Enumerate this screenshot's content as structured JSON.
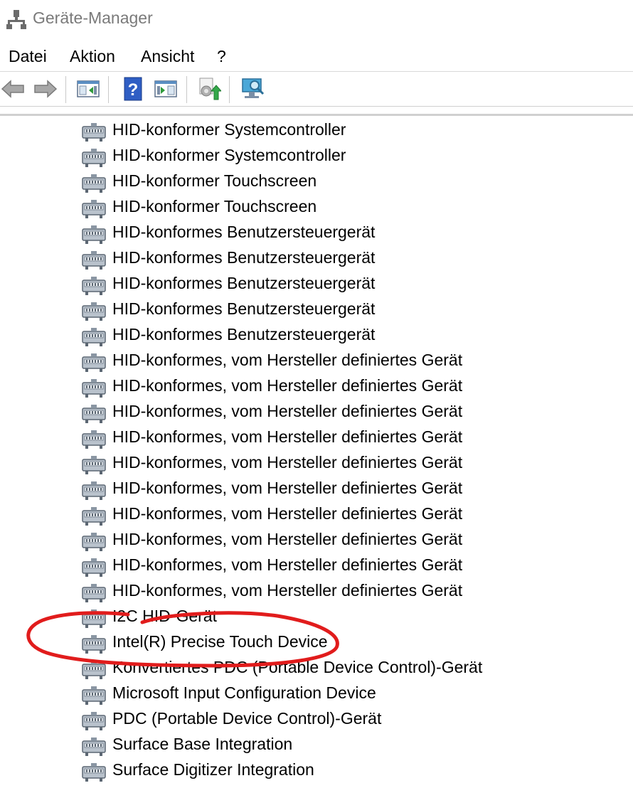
{
  "window": {
    "title": "Geräte-Manager"
  },
  "menu": [
    "Datei",
    "Aktion",
    "Ansicht",
    "?"
  ],
  "toolbar": {
    "buttons": [
      {
        "name": "back-arrow-icon"
      },
      {
        "name": "forward-arrow-icon"
      },
      {
        "name": "show-hide-console-tree-icon"
      },
      {
        "name": "help-icon"
      },
      {
        "name": "show-hide-action-pane-icon"
      },
      {
        "name": "update-driver-icon"
      },
      {
        "name": "scan-hardware-changes-icon"
      }
    ]
  },
  "devices": [
    "HID-konformer Systemcontroller",
    "HID-konformer Systemcontroller",
    "HID-konformer Touchscreen",
    "HID-konformer Touchscreen",
    "HID-konformes Benutzersteuergerät",
    "HID-konformes Benutzersteuergerät",
    "HID-konformes Benutzersteuergerät",
    "HID-konformes Benutzersteuergerät",
    "HID-konformes Benutzersteuergerät",
    "HID-konformes, vom Hersteller definiertes Gerät",
    "HID-konformes, vom Hersteller definiertes Gerät",
    "HID-konformes, vom Hersteller definiertes Gerät",
    "HID-konformes, vom Hersteller definiertes Gerät",
    "HID-konformes, vom Hersteller definiertes Gerät",
    "HID-konformes, vom Hersteller definiertes Gerät",
    "HID-konformes, vom Hersteller definiertes Gerät",
    "HID-konformes, vom Hersteller definiertes Gerät",
    "HID-konformes, vom Hersteller definiertes Gerät",
    "HID-konformes, vom Hersteller definiertes Gerät",
    "I2C HID-Gerät",
    "Intel(R) Precise Touch Device",
    "Konvertiertes PDC (Portable Device Control)-Gerät",
    "Microsoft Input Configuration Device",
    "PDC (Portable Device Control)-Gerät",
    "Surface Base Integration",
    "Surface Digitizer Integration"
  ],
  "annotation": {
    "color": "#e11c1c",
    "highlighted_item": "Intel(R) Precise Touch Device"
  }
}
